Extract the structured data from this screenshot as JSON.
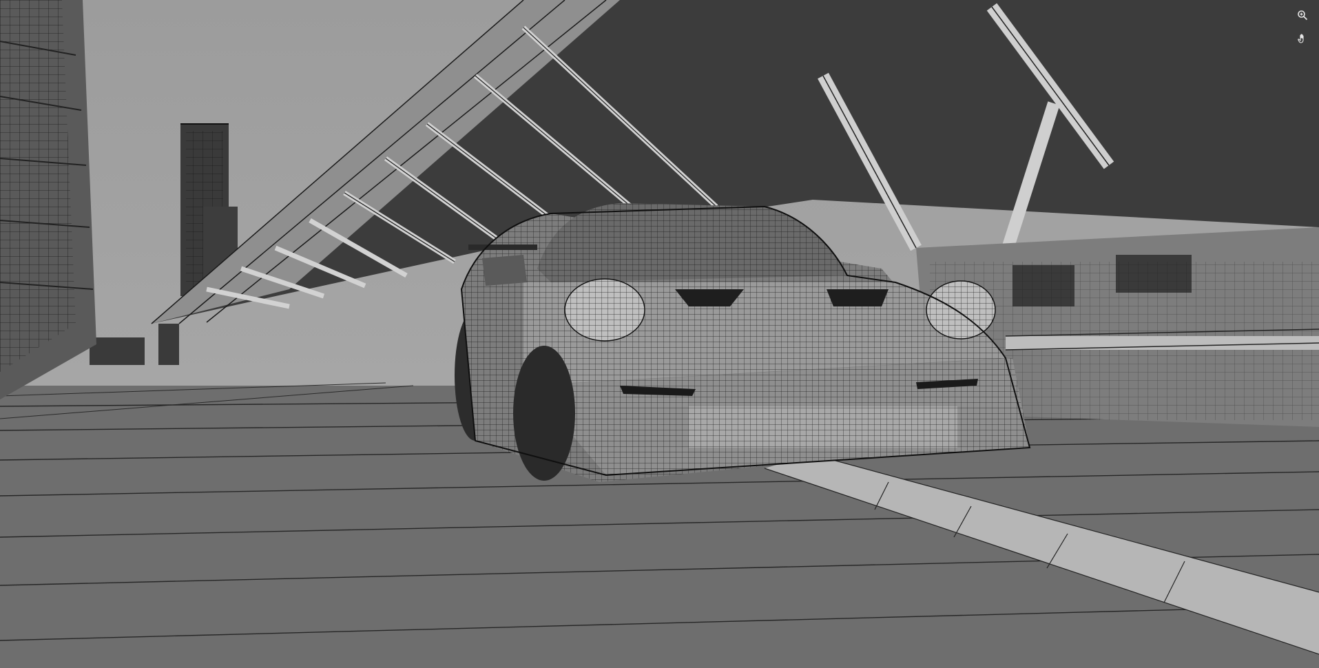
{
  "viewport": {
    "shading": "wireframe-solid",
    "background_color": "#9a9a9a",
    "road_color": "#6e6e6e",
    "structure_color": "#8a8a8a",
    "wire_color": "#1a1a1a"
  },
  "navigation": {
    "zoom_icon": "zoom-icon",
    "pan_icon": "hand-pan-icon"
  }
}
